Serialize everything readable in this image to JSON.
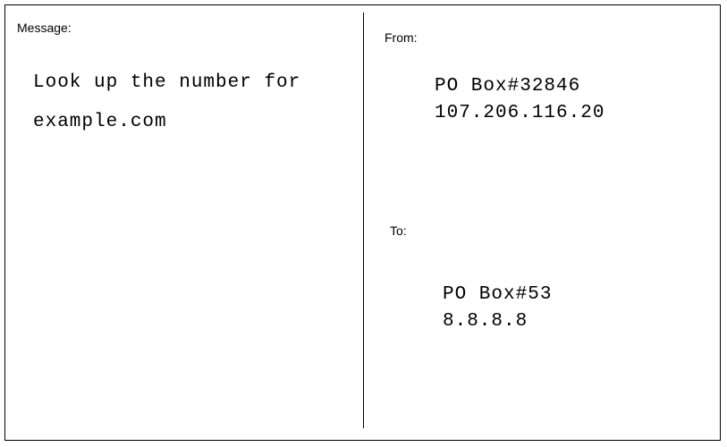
{
  "message": {
    "label": "Message:",
    "lines": [
      "Look up the number for",
      "example.com"
    ]
  },
  "from": {
    "label": "From:",
    "lines": [
      "PO Box#32846",
      "107.206.116.20"
    ]
  },
  "to": {
    "label": "To:",
    "lines": [
      "PO Box#53",
      "8.8.8.8"
    ]
  },
  "colors": {
    "ink": "#000000",
    "background": "#ffffff"
  }
}
